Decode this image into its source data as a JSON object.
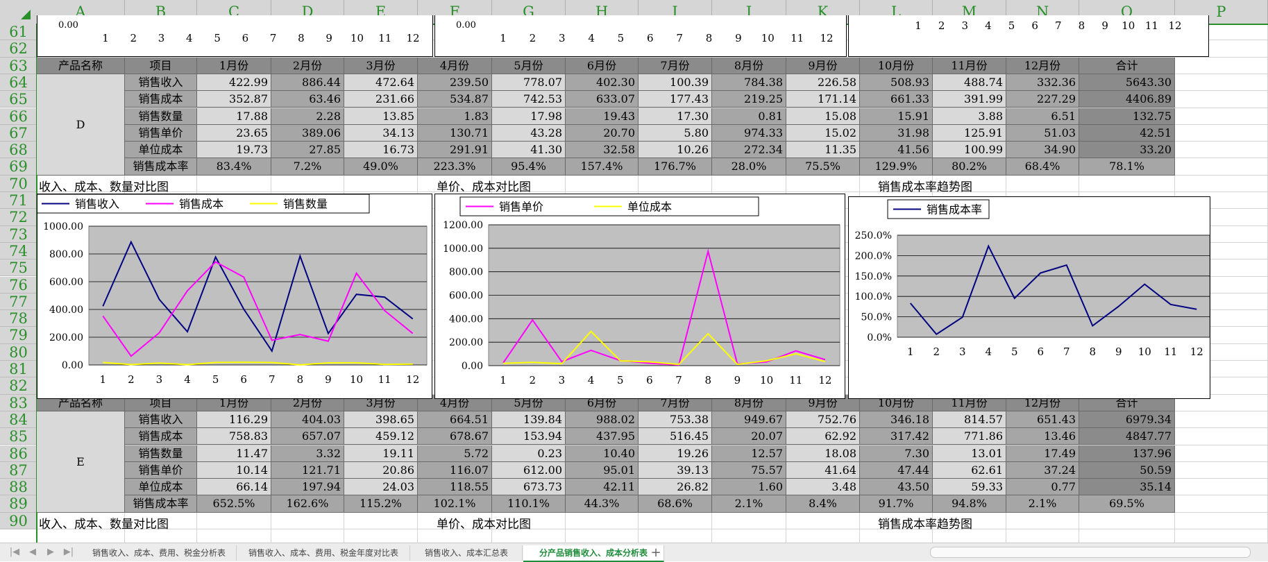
{
  "column_headers": [
    "A",
    "B",
    "C",
    "D",
    "E",
    "F",
    "G",
    "H",
    "I",
    "J",
    "K",
    "L",
    "M",
    "N",
    "O",
    "P"
  ],
  "row_numbers": [
    "61",
    "62",
    "63",
    "64",
    "65",
    "66",
    "67",
    "68",
    "69",
    "70",
    "71",
    "72",
    "73",
    "74",
    "75",
    "76",
    "77",
    "78",
    "79",
    "80",
    "81",
    "82",
    "83",
    "84",
    "85",
    "86",
    "87",
    "88",
    "89",
    "90"
  ],
  "top_partial_charts": [
    {
      "ytick": "0.00",
      "xticks": [
        "1",
        "2",
        "3",
        "4",
        "5",
        "6",
        "7",
        "8",
        "9",
        "10",
        "11",
        "12"
      ]
    },
    {
      "ytick": "0.00",
      "xticks": [
        "1",
        "2",
        "3",
        "4",
        "5",
        "6",
        "7",
        "8",
        "9",
        "10",
        "11",
        "12"
      ]
    },
    {
      "ytick": "",
      "xticks": [
        "1",
        "2",
        "3",
        "4",
        "5",
        "6",
        "7",
        "8",
        "9",
        "10",
        "11",
        "12"
      ]
    }
  ],
  "table_header": [
    "产品名称",
    "项目",
    "1月份",
    "2月份",
    "3月份",
    "4月份",
    "5月份",
    "6月份",
    "7月份",
    "8月份",
    "9月份",
    "10月份",
    "11月份",
    "12月份",
    "合计"
  ],
  "blocks": [
    {
      "product": "D",
      "rows": [
        {
          "label": "销售收入",
          "values": [
            "422.99",
            "886.44",
            "472.64",
            "239.50",
            "778.07",
            "402.30",
            "100.39",
            "784.38",
            "226.58",
            "508.93",
            "488.74",
            "332.36"
          ],
          "total": "5643.30"
        },
        {
          "label": "销售成本",
          "values": [
            "352.87",
            "63.46",
            "231.66",
            "534.87",
            "742.53",
            "633.07",
            "177.43",
            "219.25",
            "171.14",
            "661.33",
            "391.99",
            "227.29"
          ],
          "total": "4406.89"
        },
        {
          "label": "销售数量",
          "values": [
            "17.88",
            "2.28",
            "13.85",
            "1.83",
            "17.98",
            "19.43",
            "17.30",
            "0.81",
            "15.08",
            "15.91",
            "3.88",
            "6.51"
          ],
          "total": "132.75"
        },
        {
          "label": "销售单价",
          "values": [
            "23.65",
            "389.06",
            "34.13",
            "130.71",
            "43.28",
            "20.70",
            "5.80",
            "974.33",
            "15.02",
            "31.98",
            "125.91",
            "51.03"
          ],
          "total": "42.51"
        },
        {
          "label": "单位成本",
          "values": [
            "19.73",
            "27.85",
            "16.73",
            "291.91",
            "41.30",
            "32.58",
            "10.26",
            "272.34",
            "11.35",
            "41.56",
            "100.99",
            "34.90"
          ],
          "total": "33.20"
        },
        {
          "label": "销售成本率",
          "values": [
            "83.4%",
            "7.2%",
            "49.0%",
            "223.3%",
            "95.4%",
            "157.4%",
            "176.7%",
            "28.0%",
            "75.5%",
            "129.9%",
            "80.2%",
            "68.4%"
          ],
          "total": "78.1%"
        }
      ]
    },
    {
      "product": "E",
      "rows": [
        {
          "label": "销售收入",
          "values": [
            "116.29",
            "404.03",
            "398.65",
            "664.51",
            "139.84",
            "988.02",
            "753.38",
            "949.67",
            "752.76",
            "346.18",
            "814.57",
            "651.43"
          ],
          "total": "6979.34"
        },
        {
          "label": "销售成本",
          "values": [
            "758.83",
            "657.07",
            "459.12",
            "678.67",
            "153.94",
            "437.95",
            "516.45",
            "20.07",
            "62.92",
            "317.42",
            "771.86",
            "13.46"
          ],
          "total": "4847.77"
        },
        {
          "label": "销售数量",
          "values": [
            "11.47",
            "3.32",
            "19.11",
            "5.72",
            "0.23",
            "10.40",
            "19.26",
            "12.57",
            "18.08",
            "7.30",
            "13.01",
            "17.49"
          ],
          "total": "137.96"
        },
        {
          "label": "销售单价",
          "values": [
            "10.14",
            "121.71",
            "20.86",
            "116.07",
            "612.00",
            "95.01",
            "39.13",
            "75.57",
            "41.64",
            "47.44",
            "62.61",
            "37.24"
          ],
          "total": "50.59"
        },
        {
          "label": "单位成本",
          "values": [
            "66.14",
            "197.94",
            "24.03",
            "118.55",
            "673.73",
            "42.11",
            "26.82",
            "1.60",
            "3.48",
            "43.50",
            "59.33",
            "0.77"
          ],
          "total": "35.14"
        },
        {
          "label": "销售成本率",
          "values": [
            "652.5%",
            "162.6%",
            "115.2%",
            "102.1%",
            "110.1%",
            "44.3%",
            "68.6%",
            "2.1%",
            "8.4%",
            "91.7%",
            "94.8%",
            "2.1%"
          ],
          "total": "69.5%"
        }
      ]
    }
  ],
  "chart_titles": {
    "chart1": "收入、成本、数量对比图",
    "chart2": "单价、成本对比图",
    "chart3": "销售成本率趋势图"
  },
  "colors": {
    "navy": "#000080",
    "magenta": "#ff00ff",
    "yellow": "#ffff00",
    "plot_bg": "#c0c0c0",
    "accent_green": "#1e8c3a"
  },
  "chart_data": [
    {
      "type": "line",
      "title": "收入、成本、数量对比图",
      "x": [
        "1",
        "2",
        "3",
        "4",
        "5",
        "6",
        "7",
        "8",
        "9",
        "10",
        "11",
        "12"
      ],
      "ylim": [
        0,
        1000
      ],
      "yticks": [
        "0.00",
        "200.00",
        "400.00",
        "600.00",
        "800.00",
        "1000.00"
      ],
      "grid": true,
      "legend_position": "top",
      "series": [
        {
          "name": "销售收入",
          "color": "#000080",
          "values": [
            422.99,
            886.44,
            472.64,
            239.5,
            778.07,
            402.3,
            100.39,
            784.38,
            226.58,
            508.93,
            488.74,
            332.36
          ]
        },
        {
          "name": "销售成本",
          "color": "#ff00ff",
          "values": [
            352.87,
            63.46,
            231.66,
            534.87,
            742.53,
            633.07,
            177.43,
            219.25,
            171.14,
            661.33,
            391.99,
            227.29
          ]
        },
        {
          "name": "销售数量",
          "color": "#ffff00",
          "values": [
            17.88,
            2.28,
            13.85,
            1.83,
            17.98,
            19.43,
            17.3,
            0.81,
            15.08,
            15.91,
            3.88,
            6.51
          ]
        }
      ]
    },
    {
      "type": "line",
      "title": "单价、成本对比图",
      "x": [
        "1",
        "2",
        "3",
        "4",
        "5",
        "6",
        "7",
        "8",
        "9",
        "10",
        "11",
        "12"
      ],
      "ylim": [
        0,
        1200
      ],
      "yticks": [
        "0.00",
        "200.00",
        "400.00",
        "600.00",
        "800.00",
        "1000.00",
        "1200.00"
      ],
      "grid": true,
      "legend_position": "top",
      "series": [
        {
          "name": "销售单价",
          "color": "#ff00ff",
          "values": [
            23.65,
            389.06,
            34.13,
            130.71,
            43.28,
            20.7,
            5.8,
            974.33,
            15.02,
            31.98,
            125.91,
            51.03
          ]
        },
        {
          "name": "单位成本",
          "color": "#ffff00",
          "values": [
            19.73,
            27.85,
            16.73,
            291.91,
            41.3,
            32.58,
            10.26,
            272.34,
            11.35,
            41.56,
            100.99,
            34.9
          ]
        }
      ]
    },
    {
      "type": "line",
      "title": "销售成本率趋势图",
      "x": [
        "1",
        "2",
        "3",
        "4",
        "5",
        "6",
        "7",
        "8",
        "9",
        "10",
        "11",
        "12"
      ],
      "ylim": [
        0,
        250
      ],
      "yticks": [
        "0.0%",
        "50.0%",
        "100.0%",
        "150.0%",
        "200.0%",
        "250.0%"
      ],
      "grid": true,
      "legend_position": "top-left",
      "series": [
        {
          "name": "销售成本率",
          "color": "#000080",
          "values": [
            83.4,
            7.2,
            49.0,
            223.3,
            95.4,
            157.4,
            176.7,
            28.0,
            75.5,
            129.9,
            80.2,
            68.4
          ]
        }
      ]
    }
  ],
  "sheet_tabs": [
    "销售收入、成本、费用、税金分析表",
    "销售收入、成本、费用、税金年度对比表",
    "销售收入、成本汇总表",
    "分产品销售收入、成本分析表"
  ],
  "active_tab": "分产品销售收入、成本分析表",
  "add_tab_label": "+",
  "nav_icons": [
    "first-sheet-icon",
    "prev-sheet-icon",
    "next-sheet-icon",
    "last-sheet-icon"
  ]
}
